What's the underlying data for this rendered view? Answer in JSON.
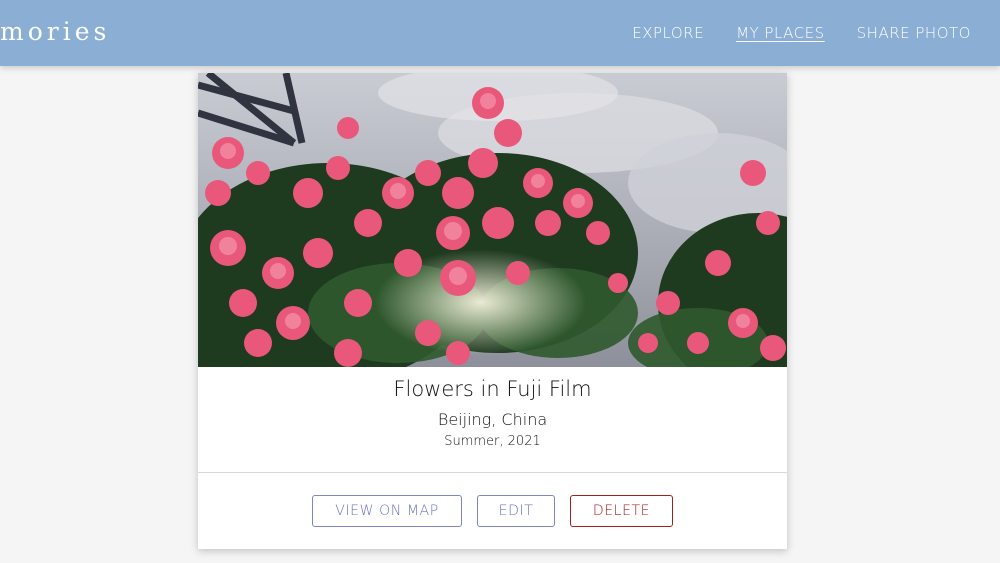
{
  "header": {
    "logo": "mories",
    "nav": [
      {
        "label": "EXPLORE",
        "active": false
      },
      {
        "label": "MY PLACES",
        "active": true
      },
      {
        "label": "SHARE PHOTO",
        "active": false
      }
    ],
    "bar_color": "#8aaed4"
  },
  "place": {
    "title": "Flowers in Fuji Film",
    "address": "Beijing, China",
    "season": "Summer, 2021",
    "photo_icon": "flower-photo"
  },
  "actions": {
    "view_on_map": "VIEW ON MAP",
    "edit": "EDIT",
    "delete": "DELETE"
  },
  "colors": {
    "primary": "#6a74c0",
    "danger": "#a32020"
  }
}
